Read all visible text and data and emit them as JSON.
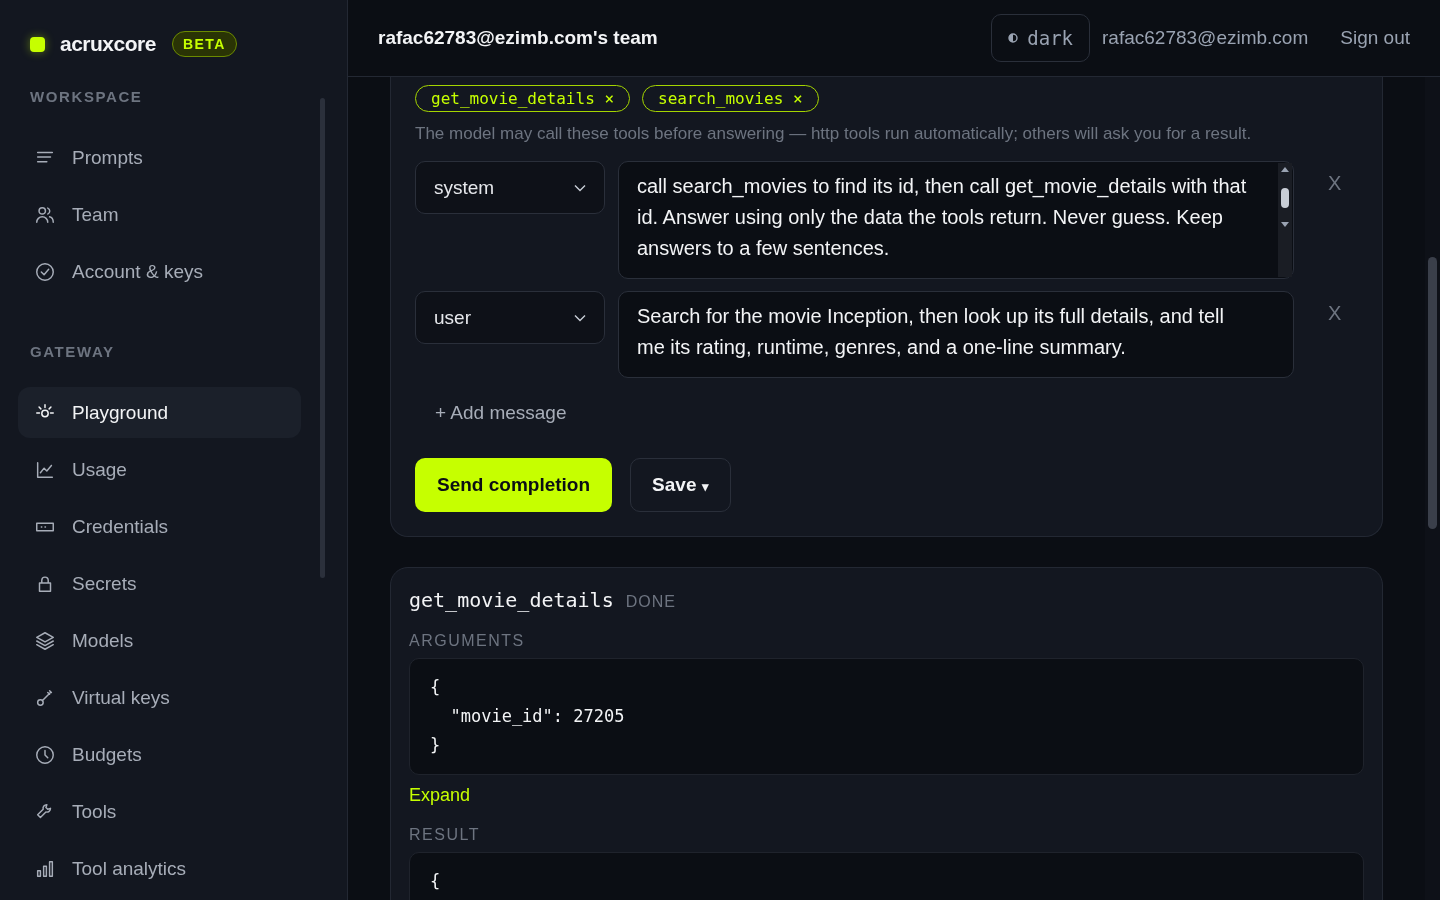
{
  "brand": {
    "name": "acruxcore",
    "badge": "BETA"
  },
  "sidebar": {
    "sections": [
      {
        "heading": "WORKSPACE",
        "items": [
          {
            "label": "Prompts",
            "selected": false
          },
          {
            "label": "Team",
            "selected": false
          },
          {
            "label": "Account & keys",
            "selected": false
          }
        ]
      },
      {
        "heading": "GATEWAY",
        "items": [
          {
            "label": "Playground",
            "selected": true
          },
          {
            "label": "Usage",
            "selected": false
          },
          {
            "label": "Credentials",
            "selected": false
          },
          {
            "label": "Secrets",
            "selected": false
          },
          {
            "label": "Models",
            "selected": false
          },
          {
            "label": "Virtual keys",
            "selected": false
          },
          {
            "label": "Budgets",
            "selected": false
          },
          {
            "label": "Tools",
            "selected": false
          },
          {
            "label": "Tool analytics",
            "selected": false
          }
        ]
      }
    ]
  },
  "header": {
    "team": "rafac62783@ezimb.com's team",
    "theme": "dark",
    "email": "rafac62783@ezimb.com",
    "sign_out": "Sign out"
  },
  "tools": {
    "chips": [
      {
        "name": "get_movie_details",
        "remove": "×"
      },
      {
        "name": "search_movies",
        "remove": "×"
      }
    ],
    "hint": "The model may call these tools before answering — http tools run automatically; others will ask you for a result."
  },
  "messages": [
    {
      "role": "system",
      "text": "call search_movies to find its id, then call get_movie_details with that id. Answer using only the data the tools return. Never guess. Keep answers to a few sentences.",
      "scrollable": true,
      "remove": "X"
    },
    {
      "role": "user",
      "text": "Search for the movie Inception, then look up its full details, and tell me its rating, runtime, genres, and a one-line summary.",
      "scrollable": false,
      "remove": "X"
    }
  ],
  "add_message": "+ Add message",
  "actions": {
    "send": "Send completion",
    "save": "Save",
    "save_caret": "▾"
  },
  "tool_call": {
    "name": "get_movie_details",
    "status": "DONE",
    "arguments_label": "ARGUMENTS",
    "arguments": "{\n  \"movie_id\": 27205\n}",
    "expand": "Expand",
    "result_label": "RESULT",
    "result": "{"
  }
}
